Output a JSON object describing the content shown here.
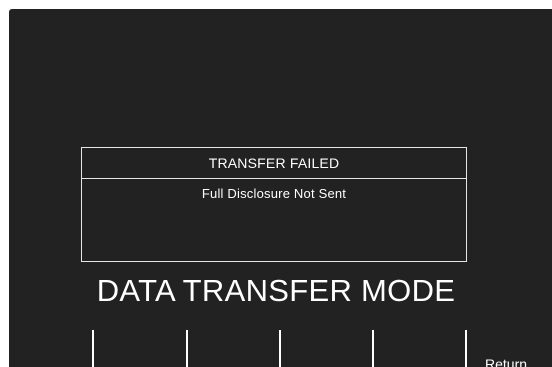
{
  "dialog": {
    "title": "TRANSFER FAILED",
    "message": "Full Disclosure Not Sent"
  },
  "mode_title": "DATA TRANSFER MODE",
  "softkeys": [
    {
      "label": ""
    },
    {
      "label": ""
    },
    {
      "label": ""
    },
    {
      "label": ""
    },
    {
      "label": "Return"
    }
  ],
  "colors": {
    "screen_background": "#222222",
    "foreground": "#ffffff"
  }
}
